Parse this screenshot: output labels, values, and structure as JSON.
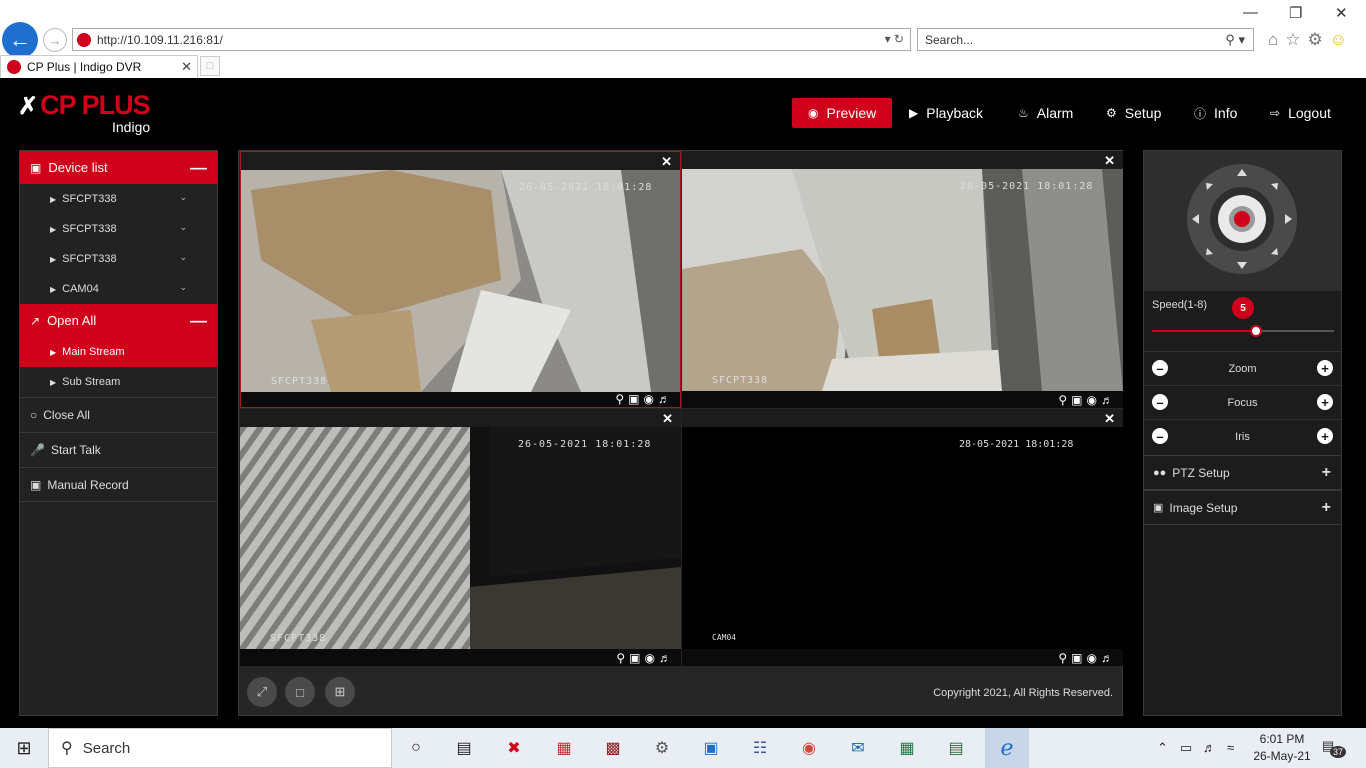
{
  "browser": {
    "url": "http://10.109.11.216:81/",
    "search_placeholder": "Search...",
    "tab_title": "CP Plus | Indigo DVR"
  },
  "brand": {
    "name": "CP PLUS",
    "sub": "Indigo"
  },
  "nav": {
    "preview": "Preview",
    "playback": "Playback",
    "alarm": "Alarm",
    "setup": "Setup",
    "info": "Info",
    "logout": "Logout"
  },
  "sidebar": {
    "device_list": "Device list",
    "devices": [
      "SFCPT338",
      "SFCPT338",
      "SFCPT338",
      "CAM04"
    ],
    "open_all": "Open All",
    "main_stream": "Main Stream",
    "sub_stream": "Sub Stream",
    "close_all": "Close All",
    "start_talk": "Start Talk",
    "manual_record": "Manual Record"
  },
  "cameras": [
    {
      "timestamp": "26-05-2021 18:01:28",
      "label": "SFCPT338"
    },
    {
      "timestamp": "26-05-2021 18:01:28",
      "label": "SFCPT338"
    },
    {
      "timestamp": "26-05-2021 18:01:28",
      "label": "SFCPT338"
    },
    {
      "timestamp": "28-05-2021 18:01:28",
      "label": "CAM04"
    }
  ],
  "footer": {
    "copyright": "Copyright 2021, All Rights Reserved."
  },
  "ptz": {
    "speed_label": "Speed(1-8)",
    "speed_value": "5",
    "speed_fraction": 0.57,
    "zoom": "Zoom",
    "focus": "Focus",
    "iris": "Iris",
    "ptz_setup": "PTZ Setup",
    "image_setup": "Image Setup"
  },
  "taskbar": {
    "search_placeholder": "Search",
    "time": "6:01 PM",
    "date": "26-May-21",
    "notifications": "37"
  },
  "colors": {
    "accent": "#d0021b",
    "panel": "#222222",
    "viewer": "#262626"
  }
}
